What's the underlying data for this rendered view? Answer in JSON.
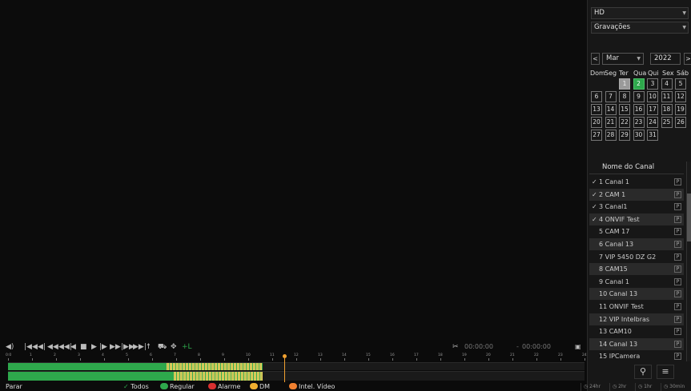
{
  "panel": {
    "quality": "HD",
    "record_type": "Gravações"
  },
  "calendar": {
    "prev": "<",
    "next": ">",
    "month": "Mar",
    "year": "2022",
    "weekdays": [
      "Dom",
      "Seg",
      "Ter",
      "Qua",
      "Qui",
      "Sex",
      "Sáb"
    ],
    "days": [
      "1",
      "2",
      "3",
      "4",
      "5",
      "6",
      "7",
      "8",
      "9",
      "10",
      "11",
      "12",
      "13",
      "14",
      "15",
      "16",
      "17",
      "18",
      "19",
      "20",
      "21",
      "22",
      "23",
      "24",
      "25",
      "26",
      "27",
      "28",
      "29",
      "30",
      "31"
    ],
    "today": "1",
    "recorded_days": [
      "2"
    ]
  },
  "channels": {
    "header": "Nome do Canal",
    "items": [
      {
        "label": "1 Canal 1",
        "checked": true,
        "p": "P"
      },
      {
        "label": "2 CAM 1",
        "checked": true,
        "p": "P"
      },
      {
        "label": "3 Canal1",
        "checked": true,
        "p": "P"
      },
      {
        "label": "4 ONVIF Test",
        "checked": true,
        "p": "P"
      },
      {
        "label": "5 CAM 17",
        "checked": false,
        "p": "P"
      },
      {
        "label": "6 Canal 13",
        "checked": false,
        "p": "P"
      },
      {
        "label": "7 VIP 5450 DZ G2",
        "checked": false,
        "p": "P"
      },
      {
        "label": "8 CAM15",
        "checked": false,
        "p": "P"
      },
      {
        "label": "9 Canal 1",
        "checked": false,
        "p": "P"
      },
      {
        "label": "10 Canal 13",
        "checked": false,
        "p": "P"
      },
      {
        "label": "11 ONVIF Test",
        "checked": false,
        "p": "P"
      },
      {
        "label": "12 VIP Intelbras",
        "checked": false,
        "p": "P"
      },
      {
        "label": "13 CAM10",
        "checked": false,
        "p": "P"
      },
      {
        "label": "14 Canal 13",
        "checked": false,
        "p": "P"
      },
      {
        "label": "15 IPCamera",
        "checked": false,
        "p": "P"
      }
    ]
  },
  "controls": {
    "time_start": "00:00:00",
    "time_sep": "-",
    "time_end": "00:00:00"
  },
  "timeline": {
    "hours": [
      "0:0",
      "1",
      "2",
      "3",
      "4",
      "5",
      "6",
      "7",
      "8",
      "9",
      "10",
      "11",
      "12",
      "13",
      "14",
      "15",
      "16",
      "17",
      "18",
      "19",
      "20",
      "21",
      "22",
      "23",
      "24"
    ],
    "cursor_hour": 11.5,
    "track1": [
      {
        "start": 0,
        "end": 10.6,
        "kind": "regular"
      },
      {
        "start": 6.6,
        "end": 10.6,
        "kind": "motion"
      }
    ],
    "track2": [
      {
        "start": 0,
        "end": 10.6,
        "kind": "regular"
      },
      {
        "start": 6.9,
        "end": 10.6,
        "kind": "motion"
      }
    ],
    "colors": {
      "regular": "#2ea84c",
      "motion": "#e8d060",
      "alarm": "#d83030",
      "md": "#f0b030",
      "intel": "#f08030"
    }
  },
  "status": {
    "left": "Parar",
    "all": "Todos",
    "regular": "Regular",
    "alarm": "Alarme",
    "md": "DM",
    "intel": "Intel. Vídeo",
    "zoom": [
      "24hr",
      "2hr",
      "1hr",
      "30min"
    ]
  }
}
